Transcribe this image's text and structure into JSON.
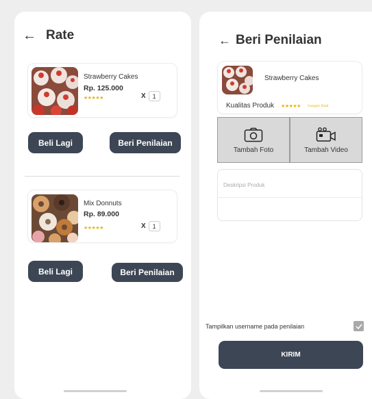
{
  "left": {
    "title": "Rate",
    "back_icon": "arrow-left-icon",
    "orders": [
      {
        "name": "Strawberry Cakes",
        "price": "Rp. 125.000",
        "rating": "★★★★★",
        "qty_label": "X",
        "qty": "1",
        "buy_again": "Beli Lagi",
        "rate_btn": "Beri Penilaian"
      },
      {
        "name": "Mix Donnuts",
        "price": "Rp. 89.000",
        "rating": "★★★★★",
        "qty_label": "X",
        "qty": "1",
        "buy_again": "Beli Lagi",
        "rate_btn": "Beri Penilaian"
      }
    ]
  },
  "right": {
    "title": "Beri Penilaian",
    "back_icon": "arrow-left-icon",
    "product_name": "Strawberry Cakes",
    "quality_label": "Kualitas Produk",
    "rating": "★★★★★",
    "rating_text": "Sangat Baik",
    "add_photo": "Tambah Foto",
    "add_video": "Tambah Video",
    "description_placeholder": "Deskripsi Produk",
    "show_username": "Tampilkan username pada penilaian",
    "submit": "KIRIM"
  },
  "colors": {
    "button": "#3d4654",
    "star": "#e8b400",
    "media_bg": "#d9d9d9"
  }
}
